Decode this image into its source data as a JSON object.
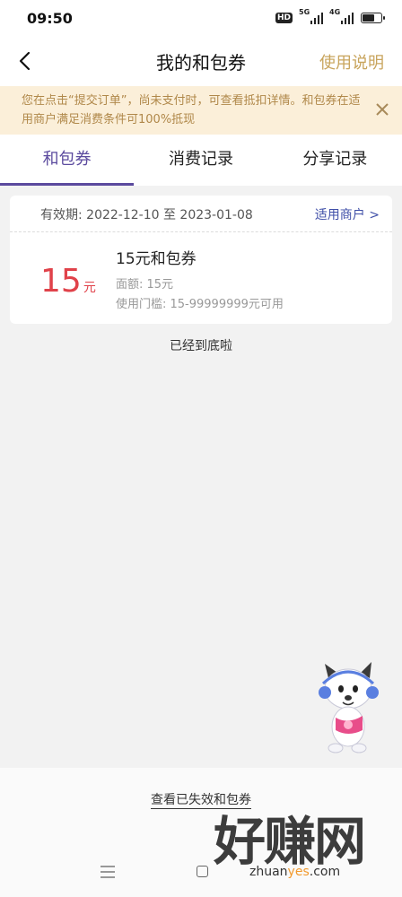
{
  "status_bar": {
    "time": "09:50",
    "hd": "HD",
    "signal_1": "5G",
    "signal_2": "4G",
    "battery_percent": 70
  },
  "header": {
    "title": "我的和包券",
    "help_link": "使用说明"
  },
  "notice": {
    "text": "您在点击“提交订单”，尚未支付时，可查看抵扣详情。和包券在适用商户满足消费条件可100%抵现"
  },
  "tabs": [
    {
      "label": "和包券",
      "active": true
    },
    {
      "label": "消费记录",
      "active": false
    },
    {
      "label": "分享记录",
      "active": false
    }
  ],
  "coupon": {
    "validity": "有效期:  2022-12-10 至 2023-01-08",
    "merchants_link": "适用商户 >",
    "amount": "15",
    "amount_unit": "元",
    "name": "15元和包券",
    "face_value": "面额:  15元",
    "threshold": "使用门槛:  15-99999999元可用"
  },
  "end_of_list": "已经到底啦",
  "expired_link": "查看已失效和包券",
  "watermark": {
    "big_text": "好赚网",
    "url_prefix": "zhuan",
    "url_highlight": "yes",
    "url_suffix": ".com"
  },
  "colors": {
    "accent_purple": "#5b4a9e",
    "gold": "#c8a45c",
    "amount_red": "#e0424a",
    "link_blue": "#3f4fa8",
    "notice_bg": "#fbefd9"
  }
}
